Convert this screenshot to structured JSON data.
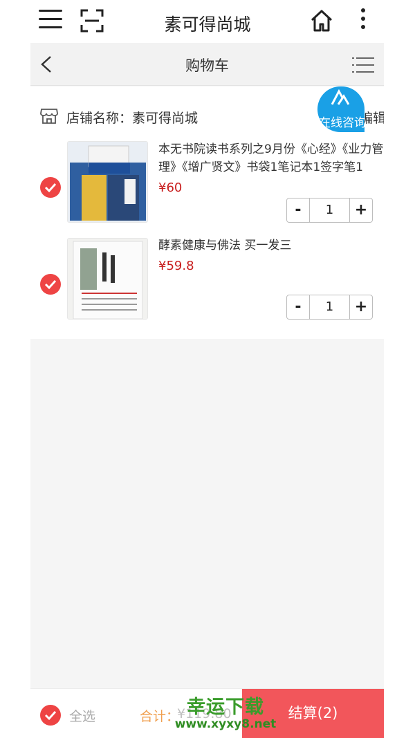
{
  "app_title": "素可得尚城",
  "header": {
    "title": "购物车"
  },
  "shop": {
    "label": "店铺名称：素可得尚城",
    "edit_label": "编辑",
    "consult_label": "在线咨询"
  },
  "items": [
    {
      "name": "本无书院读书系列之9月份《心经》《业力管理》《增广贤文》书袋1笔记本1签字笔1",
      "price": "¥60",
      "qty": "1",
      "checked": true,
      "image": "book-set-thumbnail"
    },
    {
      "name": "酵素健康与佛法 买一发三",
      "price": "¥59.8",
      "qty": "1",
      "checked": true,
      "image": "book-cover-thumbnail"
    }
  ],
  "stepper": {
    "minus": "-",
    "plus": "+"
  },
  "footer": {
    "select_all": "全选",
    "total_label": "合计：",
    "total_value": "¥119.80",
    "checkout_label": "结算(2)"
  },
  "watermark": {
    "main": "幸运下载",
    "url": "www.xyxy8.net"
  },
  "colors": {
    "accent": "#ee4444",
    "price": "#c81e1e",
    "checkout_bg": "#f2565b",
    "consult_bg": "#1aa0e6",
    "page_bg": "#f5f5f5"
  }
}
